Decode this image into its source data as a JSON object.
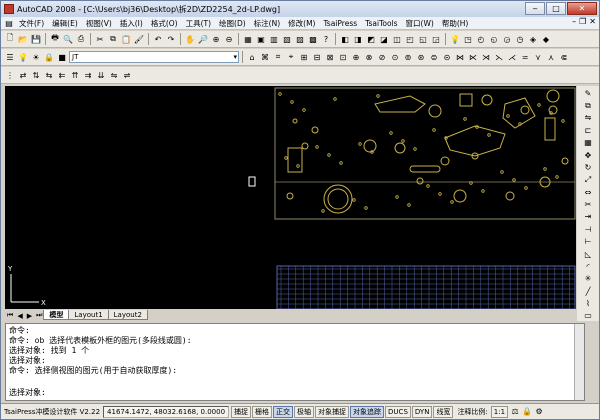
{
  "window": {
    "title": "AutoCAD 2008 - [C:\\Users\\bj36\\Desktop\\拆2D\\ZD2254_2d-LP.dwg]"
  },
  "menu": [
    "文件(F)",
    "编辑(E)",
    "视图(V)",
    "插入(I)",
    "格式(O)",
    "工具(T)",
    "绘图(D)",
    "标注(N)",
    "修改(M)",
    "TsaiPress",
    "TsaiTools",
    "窗口(W)",
    "帮助(H)"
  ],
  "toolbar": {
    "linetype_combo": "JT"
  },
  "tabs": [
    "模型",
    "Layout1",
    "Layout2"
  ],
  "ucs": {
    "x": "X",
    "y": "Y"
  },
  "command": {
    "lines": [
      "命令:",
      "命令: ob 选择代表模板外框的图元(多段线或圆):",
      "选择对象: 找到 1 个",
      "选择对象:",
      "命令: 选择侧视图的图元(用于自动获取厚度):"
    ],
    "prompt": "选择对象:"
  },
  "status": {
    "app_label": "TsaiPress冲模设计软件 V2.22",
    "coords": "41674.1472, 48032.6168, 0.0000",
    "toggles": [
      {
        "label": "捕捉",
        "on": false
      },
      {
        "label": "栅格",
        "on": false
      },
      {
        "label": "正交",
        "on": true
      },
      {
        "label": "极轴",
        "on": false
      },
      {
        "label": "对象捕捉",
        "on": false
      },
      {
        "label": "对象追踪",
        "on": true
      },
      {
        "label": "DUCS",
        "on": false
      },
      {
        "label": "DYN",
        "on": false
      },
      {
        "label": "线宽",
        "on": false
      }
    ],
    "annotation_label": "注释比例:",
    "scale": "1:1"
  },
  "colors": {
    "drawing_bg": "#000000",
    "geometry": "#c8b248",
    "geometry_dim": "#8f8a6a",
    "table_lines": "#5566aa"
  }
}
